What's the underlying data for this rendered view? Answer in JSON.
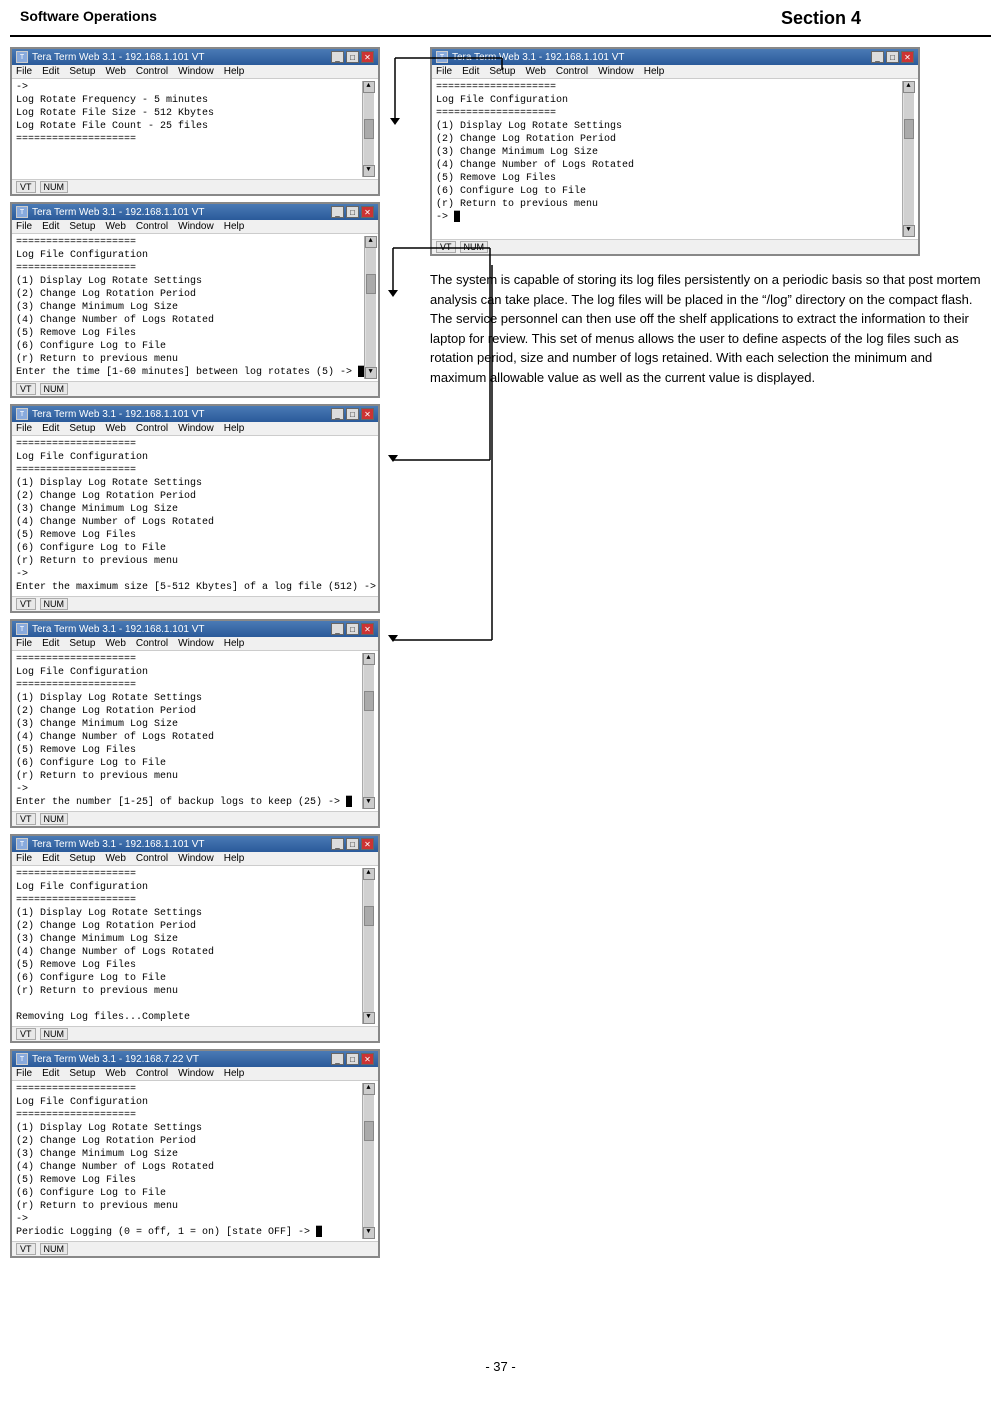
{
  "header": {
    "left_title": "Software Operations",
    "right_title": "Section 4"
  },
  "footer": {
    "page_number": "- 37 -"
  },
  "right_terminal": {
    "titlebar": "Tera Term Web 3.1 - 192.168.1.101 VT",
    "menu": [
      "File",
      "Edit",
      "Setup",
      "Web",
      "Control",
      "Window",
      "Help"
    ],
    "content": "====================\nLog File Configuration\n====================\n(1) Display Log Rotate Settings\n(2) Change Log Rotation Period\n(3) Change Minimum Log Size\n(4) Change Number of Logs Rotated\n(5) Remove Log Files\n(6) Configure Log to File\n(r) Return to previous menu\n-> "
  },
  "description": "The system is capable of storing its log files persistently on a periodic basis so that post mortem analysis can take place. The log files will be placed in the “/log” directory on the compact flash. The service personnel can then use off the shelf applications to extract the information to their laptop for review. This set of menus allows the user to define aspects of the log files such as rotation period, size and number of logs retained.  With each selection the minimum and maximum allowable value as well as the current value is displayed.",
  "terminals": [
    {
      "id": "term1",
      "titlebar": "Tera Term Web 3.1 - 192.168.1.101 VT",
      "menu": [
        "File",
        "Edit",
        "Setup",
        "Web",
        "Control",
        "Window",
        "Help"
      ],
      "content": "->\nLog Rotate Frequency - 5 minutes\nLog Rotate File Size - 512 Kbytes\nLog Rotate File Count - 25 files\n====================\n"
    },
    {
      "id": "term2",
      "titlebar": "Tera Term Web 3.1 - 192.168.1.101 VT",
      "menu": [
        "File",
        "Edit",
        "Setup",
        "Web",
        "Control",
        "Window",
        "Help"
      ],
      "content": "====================\nLog File Configuration\n====================\n(1) Display Log Rotate Settings\n(2) Change Log Rotation Period\n(3) Change Minimum Log Size\n(4) Change Number of Logs Rotated\n(5) Remove Log Files\n(6) Configure Log to File\n(r) Return to previous menu\nEnter the time [1-60 minutes] between log rotates (5) -> "
    },
    {
      "id": "term3",
      "titlebar": "Tera Term Web 3.1 - 192.168.1.101 VT",
      "menu": [
        "File",
        "Edit",
        "Setup",
        "Web",
        "Control",
        "Window",
        "Help"
      ],
      "content": "====================\nLog File Configuration\n====================\n(1) Display Log Rotate Settings\n(2) Change Log Rotation Period\n(3) Change Minimum Log Size\n(4) Change Number of Logs Rotated\n(5) Remove Log Files\n(6) Configure Log to File\n(r) Return to previous menu\n->\nEnter the maximum size [5-512 Kbytes] of a log file (512) -> "
    },
    {
      "id": "term4",
      "titlebar": "Tera Term Web 3.1 - 192.168.1.101 VT",
      "menu": [
        "File",
        "Edit",
        "Setup",
        "Web",
        "Control",
        "Window",
        "Help"
      ],
      "content": "====================\nLog File Configuration\n====================\n(1) Display Log Rotate Settings\n(2) Change Log Rotation Period\n(3) Change Minimum Log Size\n(4) Change Number of Logs Rotated\n(5) Remove Log Files\n(6) Configure Log to File\n(r) Return to previous menu\n->\nEnter the number [1-25] of backup logs to keep (25) -> "
    },
    {
      "id": "term5",
      "titlebar": "Tera Term Web 3.1 - 192.168.1.101 VT",
      "menu": [
        "File",
        "Edit",
        "Setup",
        "Web",
        "Control",
        "Window",
        "Help"
      ],
      "content": "====================\nLog File Configuration\n====================\n(1) Display Log Rotate Settings\n(2) Change Log Rotation Period\n(3) Change Minimum Log Size\n(4) Change Number of Logs Rotated\n(5) Remove Log Files\n(6) Configure Log to File\n(r) Return to previous menu\n\nRemoving Log files...Complete\n"
    },
    {
      "id": "term6",
      "titlebar": "Tera Term Web 3.1 - 192.168.7.22 VT",
      "menu": [
        "File",
        "Edit",
        "Setup",
        "Web",
        "Control",
        "Window",
        "Help"
      ],
      "content": "====================\nLog File Configuration\n====================\n(1) Display Log Rotate Settings\n(2) Change Log Rotation Period\n(3) Change Minimum Log Size\n(4) Change Number of Logs Rotated\n(5) Remove Log Files\n(6) Configure Log to File\n(r) Return to previous menu\n->\nPeriodic Logging (0 = off, 1 = on) [state OFF] -> "
    }
  ]
}
